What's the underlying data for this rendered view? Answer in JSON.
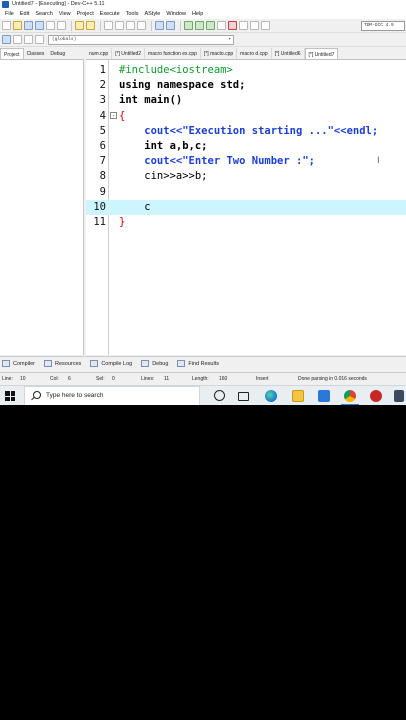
{
  "window": {
    "title": "Untitled7 - [Executing] - Dev-C++ 5.11"
  },
  "menu": [
    "File",
    "Edit",
    "Search",
    "View",
    "Project",
    "Execute",
    "Tools",
    "AStyle",
    "Window",
    "Help"
  ],
  "toolbar": {
    "compiler": "TDM-GCC 4.9",
    "scope": "(globals)"
  },
  "left_tabs": [
    "Project",
    "Classes",
    "Debug"
  ],
  "file_tabs": [
    "num.cpp",
    "[*] Untitled2",
    "macro function ex.cpp",
    "[*] macto.cpp",
    "macro d.cpp",
    "[*] Untitled6",
    "[*] Untitled7"
  ],
  "editor": {
    "current_line": 10,
    "lines": [
      {
        "n": "1",
        "code": "#include<iostream>"
      },
      {
        "n": "2",
        "code": "using namespace std;"
      },
      {
        "n": "3",
        "code": "int main()"
      },
      {
        "n": "4",
        "code": "{"
      },
      {
        "n": "5",
        "code": "    cout<<\"Execution starting ...\"<<endl;"
      },
      {
        "n": "6",
        "code": "    int a,b,c;"
      },
      {
        "n": "7",
        "code": "    cout<<\"Enter Two Number :\";"
      },
      {
        "n": "8",
        "code": "    cin>>a>>b;"
      },
      {
        "n": "9",
        "code": ""
      },
      {
        "n": "10",
        "code": "    c"
      },
      {
        "n": "11",
        "code": "}"
      }
    ],
    "fold_symbol": "-"
  },
  "bottom_tabs": [
    "Compiler",
    "Resources",
    "Compile Log",
    "Debug",
    "Find Results"
  ],
  "status": {
    "line_label": "Line:",
    "line": "10",
    "col_label": "Col:",
    "col": "6",
    "sel_label": "Sel:",
    "sel": "0",
    "lines_label": "Lines:",
    "lines": "11",
    "length_label": "Length:",
    "length": "160",
    "mode": "Insert",
    "message": "Done parsing in 0.016 seconds"
  },
  "taskbar": {
    "search_placeholder": "Type here to search",
    "icons": [
      "cortana-icon",
      "task-view-icon",
      "edge-icon",
      "file-explorer-icon",
      "mail-icon",
      "chrome-icon",
      "app-icon",
      "window-icon"
    ]
  },
  "colors": {
    "keyword": "#000000",
    "string": "#1a3fd6",
    "preprocessor": "#0e9b2d",
    "brace": "#d40000",
    "current_line": "#ccf5ff"
  }
}
